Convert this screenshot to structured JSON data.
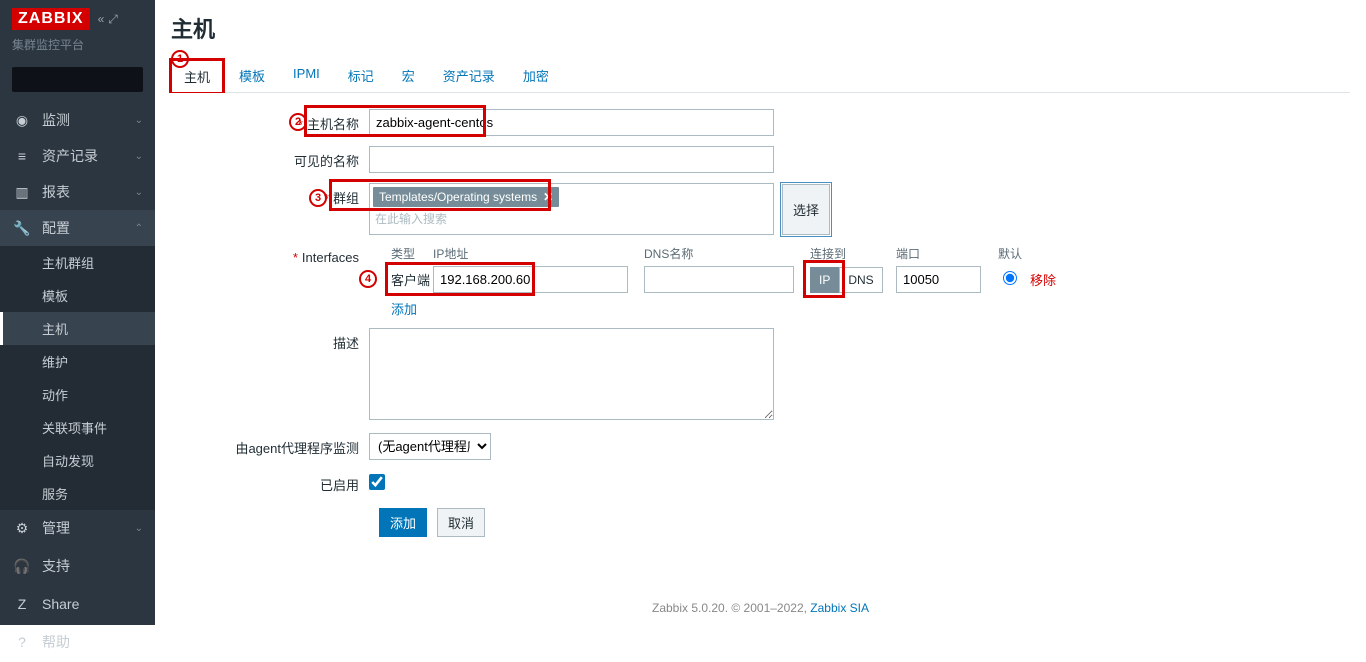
{
  "brand": {
    "logo": "ZABBIX",
    "subtitle": "集群监控平台"
  },
  "sidebar": {
    "icons": {
      "collapse": "«",
      "expand": "⤢"
    },
    "nav": [
      {
        "icon": "◉",
        "label": "监测"
      },
      {
        "icon": "≡",
        "label": "资产记录"
      },
      {
        "icon": "▥",
        "label": "报表"
      },
      {
        "icon": "🔧",
        "label": "配置"
      },
      {
        "icon": "⚙",
        "label": "管理"
      }
    ],
    "config_sub": [
      {
        "label": "主机群组"
      },
      {
        "label": "模板"
      },
      {
        "label": "主机"
      },
      {
        "label": "维护"
      },
      {
        "label": "动作"
      },
      {
        "label": "关联项事件"
      },
      {
        "label": "自动发现"
      },
      {
        "label": "服务"
      }
    ],
    "bottom": [
      {
        "icon": "🎧",
        "label": "支持"
      },
      {
        "icon": "Z",
        "label": "Share"
      },
      {
        "icon": "?",
        "label": "帮助"
      }
    ]
  },
  "page": {
    "title": "主机"
  },
  "tabs": [
    {
      "label": "主机"
    },
    {
      "label": "模板"
    },
    {
      "label": "IPMI"
    },
    {
      "label": "标记"
    },
    {
      "label": "宏"
    },
    {
      "label": "资产记录"
    },
    {
      "label": "加密"
    }
  ],
  "form": {
    "host_name": {
      "label": "主机名称",
      "value": "zabbix-agent-centos"
    },
    "visible_name": {
      "label": "可见的名称",
      "value": ""
    },
    "groups": {
      "label": "群组",
      "tags": [
        "Templates/Operating systems"
      ],
      "placeholder": "在此输入搜索",
      "select_btn": "选择"
    },
    "interfaces": {
      "label": "Interfaces",
      "headers": {
        "type": "类型",
        "ip": "IP地址",
        "dns": "DNS名称",
        "conn": "连接到",
        "port": "端口",
        "def": "默认"
      },
      "rows": [
        {
          "type": "客户端",
          "ip": "192.168.200.60",
          "dns": "",
          "conn_ip": "IP",
          "conn_dns": "DNS",
          "port": "10050",
          "remove": "移除"
        }
      ],
      "add_link": "添加"
    },
    "description": {
      "label": "描述",
      "value": ""
    },
    "agent_proxy": {
      "label": "由agent代理程序监测",
      "value": "(无agent代理程序)"
    },
    "enabled": {
      "label": "已启用"
    },
    "buttons": {
      "submit": "添加",
      "cancel": "取消"
    }
  },
  "annotations": {
    "b1": "1",
    "b2": "2",
    "b3": "3",
    "b4": "4"
  },
  "footer": {
    "text_a": "Zabbix 5.0.20. © 2001–2022, ",
    "link": "Zabbix SIA"
  }
}
